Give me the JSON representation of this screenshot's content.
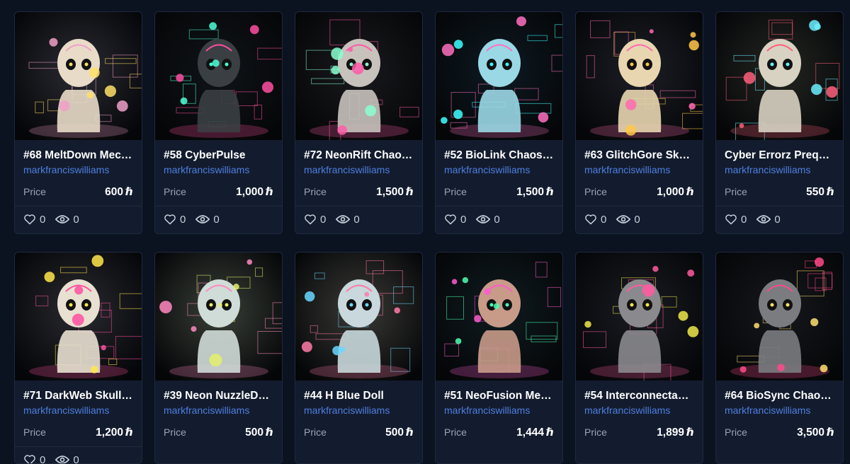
{
  "currency_symbol": "ℏ",
  "price_label": "Price",
  "cards": [
    {
      "title": "#68 MeltDown Mec…",
      "creator": "markfranciswilliams",
      "price": "600",
      "likes": "0",
      "views": "0",
      "art": {
        "bg": "#2b2b33",
        "figure": "#e8dcc8",
        "accent": "#f0a0c8",
        "glow": "#ffe066"
      }
    },
    {
      "title": "#58 CyberPulse",
      "creator": "markfranciswilliams",
      "price": "1,000",
      "likes": "0",
      "views": "0",
      "art": {
        "bg": "#101418",
        "figure": "#3a3f44",
        "accent": "#ff4fa0",
        "glow": "#4dffd6"
      }
    },
    {
      "title": "#72 NeonRift Chao…",
      "creator": "markfranciswilliams",
      "price": "1,500",
      "likes": "0",
      "views": "0",
      "art": {
        "bg": "#1a1a1e",
        "figure": "#c8c2bc",
        "accent": "#ff5aa8",
        "glow": "#8affd0"
      }
    },
    {
      "title": "#52 BioLink Chaos…",
      "creator": "markfranciswilliams",
      "price": "1,500",
      "likes": "0",
      "views": "0",
      "art": {
        "bg": "#0d1a22",
        "figure": "#9ad8e6",
        "accent": "#ff70c0",
        "glow": "#3dffff"
      }
    },
    {
      "title": "#63 GlitchGore Sk…",
      "creator": "markfranciswilliams",
      "price": "1,000",
      "likes": "0",
      "views": "0",
      "art": {
        "bg": "#1c1f26",
        "figure": "#e8d6b0",
        "accent": "#ff6ab0",
        "glow": "#ffc84a"
      }
    },
    {
      "title": "Cyber Errorz Prequ…",
      "creator": "markfranciswilliams",
      "price": "550",
      "likes": "0",
      "views": "0",
      "art": {
        "bg": "#242622",
        "figure": "#d8d2c2",
        "accent": "#ff5e7a",
        "glow": "#6af0ff"
      }
    },
    {
      "title": "#71 DarkWeb Skull…",
      "creator": "markfranciswilliams",
      "price": "1,200",
      "likes": "0",
      "views": "0",
      "art": {
        "bg": "#2a2a30",
        "figure": "#e8e0d0",
        "accent": "#ff4fa0",
        "glow": "#ffe84a"
      }
    },
    {
      "title": "#39 Neon NuzzleD…",
      "creator": "markfranciswilliams",
      "price": "500",
      "likes": "",
      "views": "",
      "art": {
        "bg": "#3a4038",
        "figure": "#d0dcd8",
        "accent": "#ff88c0",
        "glow": "#e6f06a"
      }
    },
    {
      "title": "#44 H Blue Doll",
      "creator": "markfranciswilliams",
      "price": "500",
      "likes": "",
      "views": "",
      "art": {
        "bg": "#3a3a36",
        "figure": "#c8d8dc",
        "accent": "#ff7aa8",
        "glow": "#6ad8ff"
      }
    },
    {
      "title": "#51 NeoFusion Me…",
      "creator": "markfranciswilliams",
      "price": "1,444",
      "likes": "",
      "views": "",
      "art": {
        "bg": "#0f1c20",
        "figure": "#c89a88",
        "accent": "#ff5ad0",
        "glow": "#4affb0"
      }
    },
    {
      "title": "#54 InterconnectaT…",
      "creator": "markfranciswilliams",
      "price": "1,899",
      "likes": "",
      "views": "",
      "art": {
        "bg": "#1a1c22",
        "figure": "#8a8a8e",
        "accent": "#ff5aa0",
        "glow": "#f0e84a"
      }
    },
    {
      "title": "#64 BioSync Chao…",
      "creator": "markfranciswilliams",
      "price": "3,500",
      "likes": "",
      "views": "",
      "art": {
        "bg": "#16181c",
        "figure": "#7a7c80",
        "accent": "#ff4a8a",
        "glow": "#ffe070"
      }
    }
  ]
}
